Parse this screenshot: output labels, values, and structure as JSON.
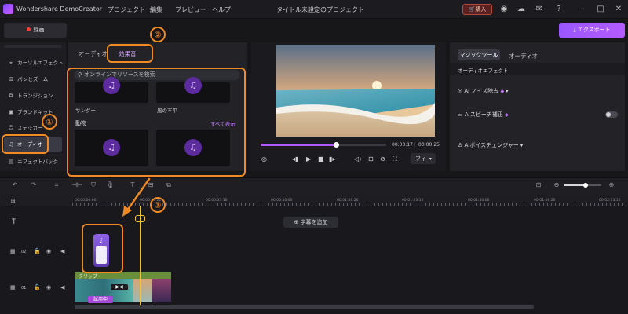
{
  "app": {
    "name": "Wondershare DemoCreator",
    "menu": [
      "プロジェクト",
      "編集",
      "プレビュー",
      "ヘルプ"
    ],
    "title": "タイトル未設定のプロジェクト",
    "buy_label": "購入"
  },
  "toolbar": {
    "record_label": "録画",
    "export_label": "エクスポート"
  },
  "sidebar": {
    "items": [
      {
        "label": "カーソルエフェクト",
        "icon": "cursor-icon"
      },
      {
        "label": "パンとズーム",
        "icon": "pan-zoom-icon"
      },
      {
        "label": "トランジション",
        "icon": "transition-icon"
      },
      {
        "label": "ブランドキット",
        "icon": "brand-kit-icon"
      },
      {
        "label": "ステッカー",
        "icon": "sticker-icon"
      },
      {
        "label": "オーディオ",
        "icon": "music-note-icon",
        "active": true
      },
      {
        "label": "エフェクトパック",
        "icon": "effect-pack-icon"
      }
    ]
  },
  "media": {
    "tabs": [
      "オーディオ",
      "効果音"
    ],
    "active_tab": "効果音",
    "search_placeholder": "オンラインでリソースを検索",
    "top_items": [
      "サンダー",
      "風の不平"
    ],
    "section_title": "動物",
    "show_all_label": "すべて表示"
  },
  "preview": {
    "current_time": "00:00:17",
    "total_time": "00:00:25",
    "progress": 0.6,
    "fit_label": "フィ"
  },
  "magic": {
    "tabs": [
      "マジックツール",
      "オーディオ"
    ],
    "active_tab": "マジックツール",
    "section_title": "オーディオエフェクト",
    "rows": [
      {
        "label": "AI ノイズ除去",
        "icon": "ai-denoise-icon"
      },
      {
        "label": "AIスピーチ補正",
        "icon": "speech-icon"
      },
      {
        "label": "AIボイスチェンジャー",
        "icon": "voice-changer-icon"
      }
    ]
  },
  "timeline": {
    "ruler": [
      "00:00:00:00",
      "00:00:16:20",
      "00:00:33:10",
      "00:00:50:00",
      "00:01:06:20",
      "00:01:23:10",
      "00:01:40:00",
      "00:01:56:20",
      "00:02:13:10"
    ],
    "add_caption_label": "字幕を追加",
    "track_numbers": [
      "02",
      "01"
    ],
    "clip_label": "クリップ",
    "trial_label": "試用中"
  },
  "annotations": [
    "①",
    "②",
    "③"
  ],
  "colors": {
    "accent": "#b45bff",
    "annotation": "#f08a24",
    "record": "#ff3b3b"
  }
}
